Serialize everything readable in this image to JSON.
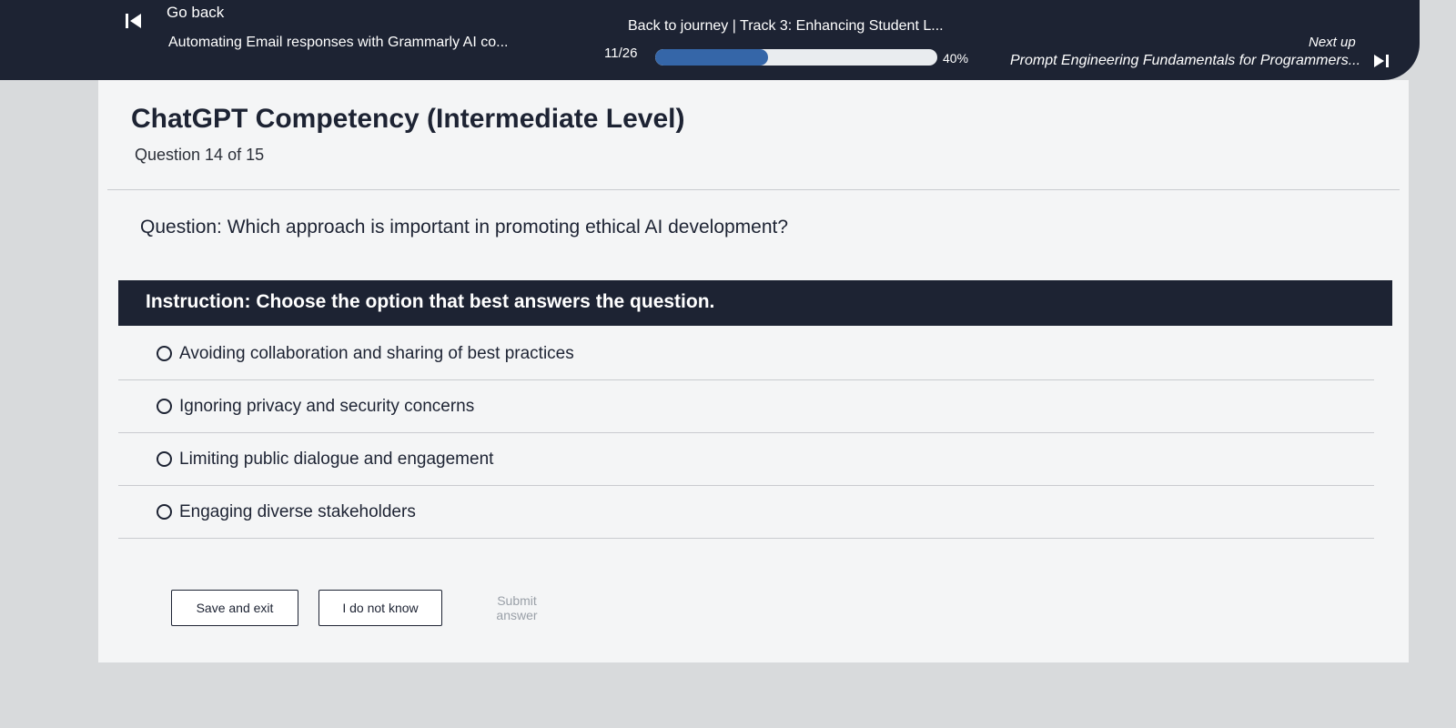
{
  "nav": {
    "go_back": "Go back",
    "previous_title": "Automating Email responses with Grammarly AI co...",
    "journey": "Back to journey  |  Track 3: Enhancing Student L...",
    "progress_count": "11/26",
    "progress_percent_label": "40%",
    "progress_value": 0.4,
    "next_up_label": "Next up",
    "next_title": "Prompt Engineering Fundamentals for Programmers..."
  },
  "quiz": {
    "title": "ChatGPT Competency (Intermediate Level)",
    "question_count": "Question 14 of 15",
    "question": "Question: Which approach is important in promoting ethical AI development?",
    "instruction": "Instruction: Choose the option that best answers the question.",
    "options": [
      "Avoiding collaboration and sharing of best practices",
      "Ignoring privacy and security concerns",
      "Limiting public dialogue and engagement",
      "Engaging diverse stakeholders"
    ]
  },
  "actions": {
    "save_exit": "Save and exit",
    "dont_know": "I do not know",
    "submit": "Submit answer"
  },
  "colors": {
    "nav_bg": "#1d2333",
    "progress_fill": "#3566a8",
    "instruction_bg": "#1d2333"
  },
  "icons": {
    "previous": "skip-previous-icon",
    "next": "skip-next-icon",
    "radio": "radio-unchecked-icon"
  }
}
